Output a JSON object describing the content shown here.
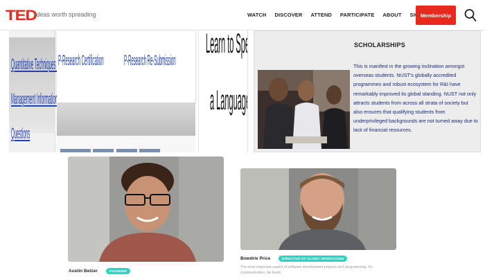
{
  "header": {
    "logo": "TED",
    "tagline": "Ideas worth spreading",
    "nav": [
      "WATCH",
      "DISCOVER",
      "ATTEND",
      "PARTICIPATE",
      "ABOUT",
      "SIGN IN"
    ],
    "membership_label": "Membership",
    "search_icon": "search-icon",
    "accent_color": "#e62b1e"
  },
  "left_panel": {
    "lines": [
      "Quantitative Techniques for",
      "Management Information",
      "Questions"
    ]
  },
  "mid_panel": {
    "links": [
      "P-Research Certification",
      "P-Research Re-Submission"
    ]
  },
  "lang_panel": {
    "line1": "Learn to Speak",
    "line2": "a Language"
  },
  "scholarships": {
    "title": "SCHOLARSHIPS",
    "body": "This is manifest in the growing inclination amongst overseas students. NUST's globally accredited programmes and robust ecosystem for R&I have remarkably improved its global standing. NUST not only attracts students from across all strata of society but also ensures that qualifying students from underprivileged backgrounds are not turned away due to lack of financial resources."
  },
  "team": {
    "member1": {
      "name": "Austin Betzer",
      "role": "FOUNDER"
    },
    "member2": {
      "name": "Bowdrie Price",
      "role": "DIRECTOR OF CLIENT OPERATIONS",
      "bio": "The most important aspect of software development projects isn't programming. It's communication. He leads"
    },
    "badge_color": "#2fd4c0"
  }
}
